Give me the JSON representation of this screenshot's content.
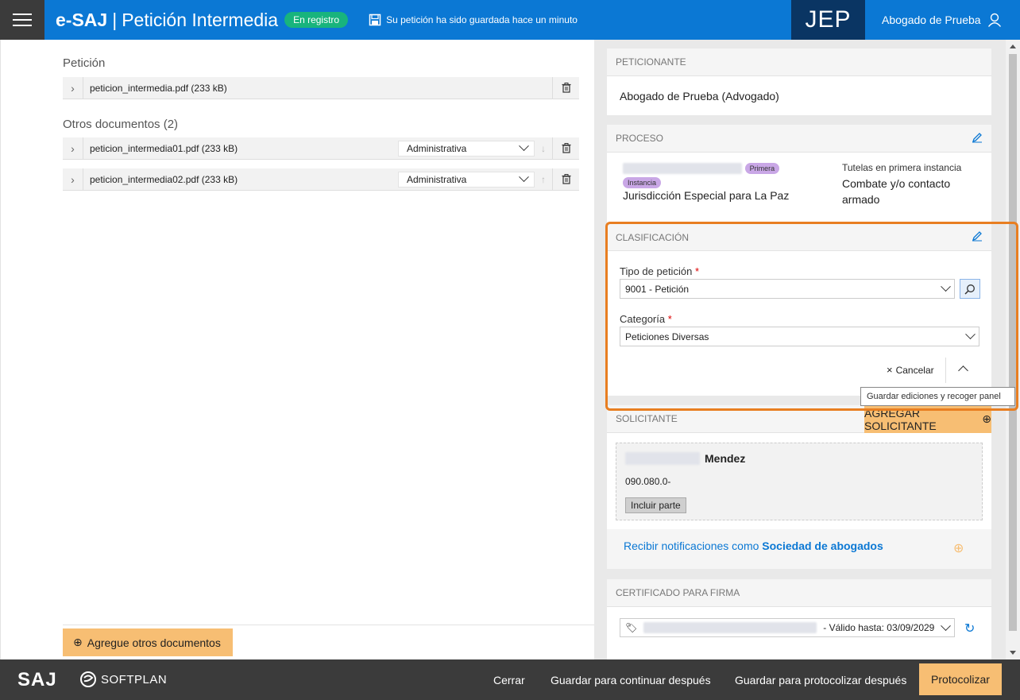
{
  "header": {
    "brand": "e-SAJ",
    "separator": "|",
    "title": "Petición Intermedia",
    "badge": "En registro",
    "saved_text": "Su petición ha sido guardada hace un minuto",
    "institution": "JEP",
    "user": "Abogado de Prueba"
  },
  "left": {
    "peticion_title": "Petición",
    "peticion_file": "peticion_intermedia.pdf (233 kB)",
    "otros_title": "Otros documentos (2)",
    "otros": [
      {
        "name": "peticion_intermedia01.pdf (233 kB)",
        "type": "Administrativa",
        "arrow": "↓"
      },
      {
        "name": "peticion_intermedia02.pdf (233 kB)",
        "type": "Administrativa",
        "arrow": "↑"
      }
    ],
    "add_docs": "Agregue otros documentos"
  },
  "peticionante": {
    "title": "PETICIONANTE",
    "name": "Abogado de Prueba (Advogado)"
  },
  "proceso": {
    "title": "PROCESO",
    "pill_top": "Primera",
    "pill_bottom": "Instancia",
    "jurisdiction": "Jurisdicción Especial para La Paz",
    "class_small": "Tutelas en primera instancia",
    "class_line1": "Combate y/o contacto",
    "class_line2": "armado"
  },
  "clasificacion": {
    "title": "CLASIFICACIÓN",
    "tipo_label": "Tipo de petición",
    "tipo_value": "9001 - Petición",
    "categoria_label": "Categoría",
    "categoria_value": "Peticiones Diversas",
    "cancel": "Cancelar",
    "required_mark": "*",
    "tooltip": "Guardar ediciones y recoger panel"
  },
  "solicitante": {
    "title": "SOLICITANTE",
    "add": "Agregar solicitante",
    "surname": "Mendez",
    "doc": "090.080.0-",
    "incluir": "Incluir parte",
    "notif_prefix": "Recibir notificaciones como ",
    "notif_bold": "Sociedad de abogados"
  },
  "certificado": {
    "title": "CERTIFICADO PARA FIRMA",
    "valid": "- Válido hasta: 03/09/2029"
  },
  "footer": {
    "saj": "SAJ",
    "softplan": "SOFTPLAN",
    "cerrar": "Cerrar",
    "guardar_continuar": "Guardar para continuar después",
    "guardar_protocolizar": "Guardar para protocolizar después",
    "protocolizar": "Protocolizar"
  },
  "colors": {
    "header_blue": "#0b78d4",
    "jep_navy": "#0a3563",
    "badge_green": "#18b47d",
    "accent_orange": "#f7be73",
    "highlight_orange": "#e87e21"
  }
}
